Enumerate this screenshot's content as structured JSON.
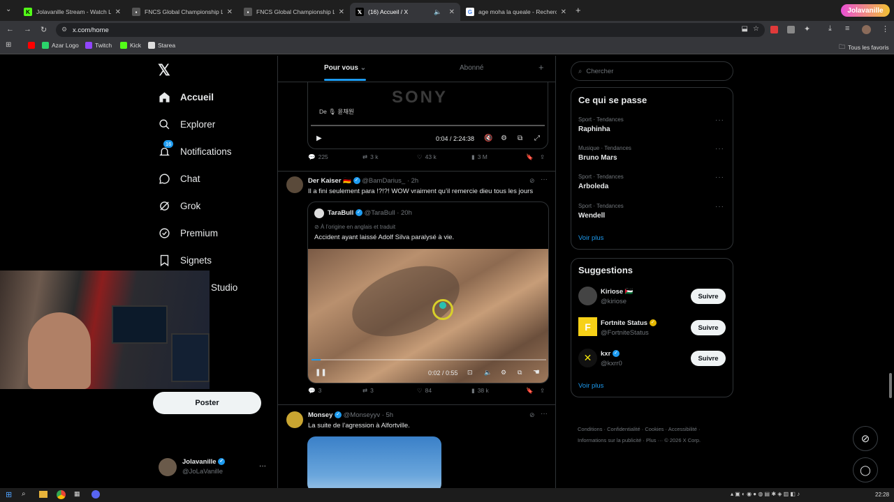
{
  "browser": {
    "tabs": [
      {
        "title": "Jolavanille Stream - Watch Live"
      },
      {
        "title": "FNCS Global Championship La"
      },
      {
        "title": "FNCS Global Championship La"
      },
      {
        "title": "(16) Accueil / X"
      },
      {
        "title": "age moha la queale - Recherche"
      }
    ],
    "url": "x.com/home",
    "bookmarks": [
      "Azar Logo",
      "Twitch",
      "Kick",
      "Starea"
    ],
    "all_bookmarks": "Tous les favoris",
    "brand_badge": "Jolavanille",
    "accent": "#1d9bf0"
  },
  "nav": {
    "items": [
      {
        "label": "Accueil",
        "icon": "home-icon"
      },
      {
        "label": "Explorer",
        "icon": "search-icon"
      },
      {
        "label": "Notifications",
        "icon": "bell-icon",
        "badge": "16"
      },
      {
        "label": "Chat",
        "icon": "chat-icon"
      },
      {
        "label": "Grok",
        "icon": "grok-icon"
      },
      {
        "label": "Premium",
        "icon": "premium-icon"
      },
      {
        "label": "Signets",
        "icon": "bookmark-icon"
      },
      {
        "label": "Studio",
        "icon": "studio-icon"
      }
    ],
    "post_button": "Poster",
    "account": {
      "name": "Jolavanille",
      "handle": "@JoLaVanille"
    }
  },
  "feed": {
    "tabs": [
      "Pour vous",
      "Abonné"
    ],
    "video1": {
      "overlay": "SONY",
      "caption": "De 🎙 윤채원",
      "time": "0:04 / 2:24:38"
    },
    "post1_stats": {
      "replies": "225",
      "reposts": "3 k",
      "likes": "43 k",
      "views": "3 M"
    },
    "post2": {
      "author": "Der Kaiser 🇩🇪",
      "handle": "@BamDarius_",
      "time": "· 2h",
      "text": "Il a fini seulement para !?!?! WOW vraiment qu’il remercie dieu tous les jours",
      "quote": {
        "author": "TaraBull",
        "handle": "@TaraBull",
        "time": "· 20h",
        "translated": "À l’origine en anglais et traduit",
        "text": "Accident ayant laissé Adolf Silva paralysé à vie.",
        "video_time": "0:02 / 0:55",
        "progress": 0.04
      },
      "stats": {
        "replies": "3",
        "reposts": "3",
        "likes": "84",
        "views": "38 k"
      }
    },
    "post3": {
      "author": "Monsey",
      "handle": "@Monseyyv",
      "time": "· 5h",
      "text": "La suite de l’agression à Alfortville."
    }
  },
  "sidebar": {
    "search_placeholder": "Chercher",
    "trends_title": "Ce qui se passe",
    "trends": [
      {
        "category": "Sport · Tendances",
        "name": "Raphinha"
      },
      {
        "category": "Musique · Tendances",
        "name": "Bruno Mars"
      },
      {
        "category": "Sport · Tendances",
        "name": "Arboleda"
      },
      {
        "category": "Sport · Tendances",
        "name": "Wendell"
      }
    ],
    "show_more": "Voir plus",
    "suggestions_title": "Suggestions",
    "suggestions": [
      {
        "name": "Kiriose 🇵🇸",
        "handle": "@kiriose",
        "button": "Suivre"
      },
      {
        "name": "Fortnite Status",
        "handle": "@FortniteStatus",
        "button": "Suivre"
      },
      {
        "name": "kxr",
        "handle": "@kxrr0",
        "button": "Suivre"
      }
    ],
    "show_more2": "Voir plus",
    "footer1": [
      "Conditions",
      "Confidentialité",
      "Cookies",
      "Accessibilité"
    ],
    "footer2": [
      "Informations sur la publicité",
      "Plus ···",
      "© 2026 X Corp."
    ]
  },
  "taskbar": {
    "clock": "22:28"
  }
}
